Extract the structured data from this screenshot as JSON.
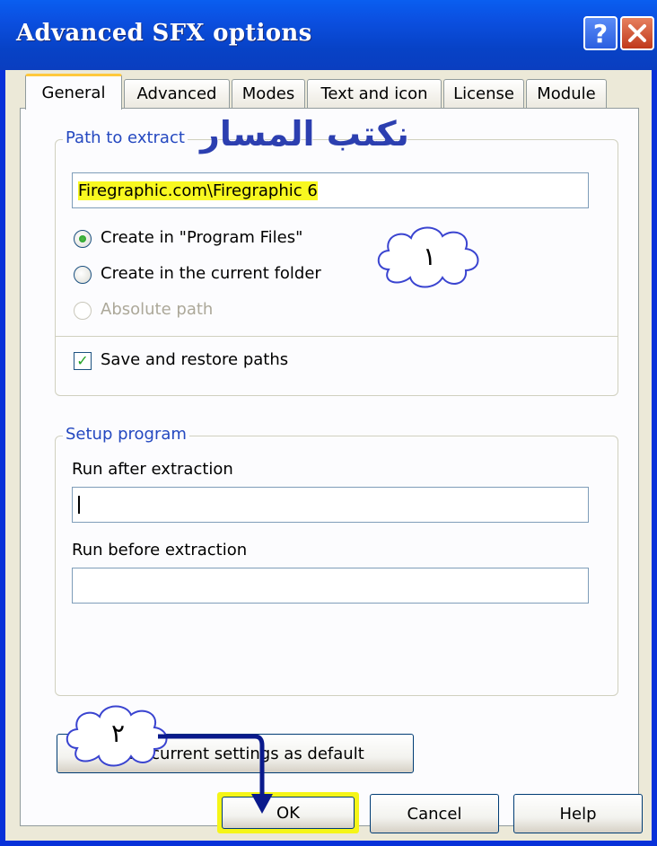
{
  "window": {
    "title": "Advanced SFX options",
    "help_symbol": "?",
    "close_symbol": "X"
  },
  "tabs": [
    {
      "label": "General",
      "active": true
    },
    {
      "label": "Advanced",
      "active": false
    },
    {
      "label": "Modes",
      "active": false
    },
    {
      "label": "Text and icon",
      "active": false
    },
    {
      "label": "License",
      "active": false
    },
    {
      "label": "Module",
      "active": false
    }
  ],
  "path_group": {
    "legend": "Path to extract",
    "annotation_arabic": "نكتب المسار",
    "path_value": "Firegraphic.com\\Firegraphic 6",
    "radio_program_files": "Create in \"Program Files\"",
    "radio_current_folder": "Create in the current folder",
    "radio_absolute": "Absolute path",
    "selected_radio": "program_files",
    "save_restore_label": "Save and restore paths",
    "save_restore_checked": true
  },
  "setup_group": {
    "legend": "Setup program",
    "run_after_label": "Run after extraction",
    "run_after_value": "",
    "run_before_label": "Run before extraction",
    "run_before_value": ""
  },
  "buttons": {
    "save_default": "Save current settings as default",
    "ok": "OK",
    "cancel": "Cancel",
    "help": "Help"
  },
  "annotations": {
    "step1": "١",
    "step2": "٢"
  },
  "colors": {
    "title_bar": "#0b4fe0",
    "highlight": "#f8f820",
    "arrow": "#0a1a8c",
    "annotation_text": "#2c3fb0"
  }
}
